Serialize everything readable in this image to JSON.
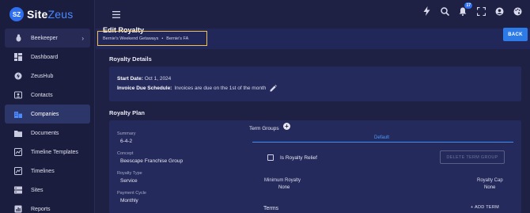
{
  "app": {
    "logo_badge": "SZ",
    "logo_site": "Site",
    "logo_zeus": "Zeus"
  },
  "sidebar": {
    "items": [
      {
        "label": "Beekeeper",
        "icon": "beekeeper-icon",
        "has_chevron": true
      },
      {
        "label": "Dashboard",
        "icon": "dashboard-icon"
      },
      {
        "label": "ZeusHub",
        "icon": "zeushub-icon"
      },
      {
        "label": "Contacts",
        "icon": "contacts-icon"
      },
      {
        "label": "Companies",
        "icon": "companies-icon",
        "active": true
      },
      {
        "label": "Documents",
        "icon": "folder-icon"
      },
      {
        "label": "Timeline Templates",
        "icon": "timeline-templates-icon"
      },
      {
        "label": "Timelines",
        "icon": "timelines-icon"
      },
      {
        "label": "Sites",
        "icon": "sites-icon"
      },
      {
        "label": "Reports",
        "icon": "reports-icon"
      }
    ]
  },
  "topbar": {
    "notification_count": "17"
  },
  "page": {
    "title": "Edit Royalty",
    "breadcrumb": [
      "Bernie's Weekend Getaways",
      "Bernie's FA"
    ],
    "breadcrumb_sep": "•",
    "back_label": "BACK"
  },
  "royalty_details": {
    "section_title": "Royalty Details",
    "start_date_label": "Start Date:",
    "start_date": "Oct 1, 2024",
    "invoice_label": "Invoice Due Schedule:",
    "invoice_value": "Invoices are due on the 1st of the month"
  },
  "royalty_plan": {
    "section_title": "Royalty Plan",
    "summary_label": "Summary",
    "summary_value": "6-4-2",
    "concept_label": "Concept",
    "concept_value": "Beescape Franchise Group",
    "type_label": "Royalty Type",
    "type_value": "Service",
    "cycle_label": "Payment Cycle",
    "cycle_value": "Monthly",
    "term_groups_label": "Term Groups",
    "add_symbol": "+",
    "tab_default": "Default",
    "relief_label": "Is Royalty Relief",
    "delete_label": "DELETE TERM GROUP",
    "min_royalty_label": "Minimum Royalty",
    "min_royalty_value": "None",
    "royalty_cap_label": "Royalty Cap",
    "royalty_cap_value": "None",
    "terms_label": "Terms",
    "add_term_label": "+ ADD TERM"
  },
  "colors": {
    "background": "#1e2044",
    "accent": "#2d7be6",
    "highlight": "#f2c14e"
  }
}
